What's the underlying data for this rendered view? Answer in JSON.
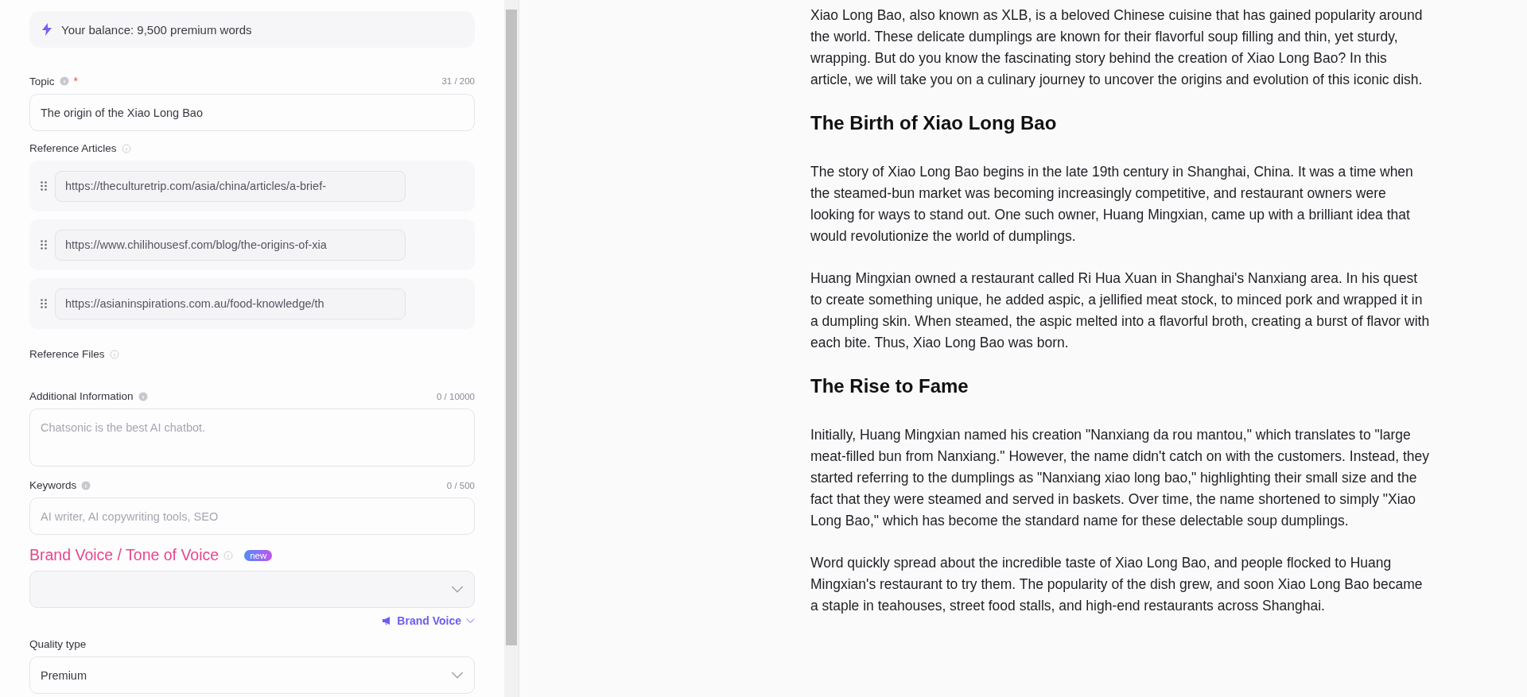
{
  "balance": {
    "text": "Your balance: 9,500 premium words"
  },
  "topic": {
    "label": "Topic",
    "required_mark": "*",
    "counter": "31 / 200",
    "value": "The origin of the Xiao Long Bao"
  },
  "reference_articles": {
    "label": "Reference Articles",
    "items": [
      {
        "url": "https://theculturetrip.com/asia/china/articles/a-brief-"
      },
      {
        "url": "https://www.chilihousesf.com/blog/the-origins-of-xia"
      },
      {
        "url": "https://asianinspirations.com.au/food-knowledge/th"
      }
    ]
  },
  "reference_files": {
    "label": "Reference Files"
  },
  "additional_information": {
    "label": "Additional Information",
    "counter": "0 / 10000",
    "placeholder": "Chatsonic is the best AI chatbot."
  },
  "keywords": {
    "label": "Keywords",
    "counter": "0 / 500",
    "placeholder": "AI writer, AI copywriting tools, SEO"
  },
  "brand_voice": {
    "label": "Brand Voice / Tone of Voice",
    "badge": "new",
    "link": "Brand Voice"
  },
  "quality_type": {
    "label": "Quality type",
    "value": "Premium"
  },
  "article": [
    {
      "kind": "paragraph",
      "text": "Xiao Long Bao, also known as XLB, is a beloved Chinese cuisine that has gained popularity around the world. These delicate dumplings are known for their flavorful soup filling and thin, yet sturdy, wrapping. But do you know the fascinating story behind the creation of Xiao Long Bao? In this article, we will take you on a culinary journey to uncover the origins and evolution of this iconic dish."
    },
    {
      "kind": "heading",
      "text": "The Birth of Xiao Long Bao"
    },
    {
      "kind": "paragraph",
      "text": "The story of Xiao Long Bao begins in the late 19th century in Shanghai, China. It was a time when the steamed-bun market was becoming increasingly competitive, and restaurant owners were looking for ways to stand out. One such owner, Huang Mingxian, came up with a brilliant idea that would revolutionize the world of dumplings."
    },
    {
      "kind": "paragraph",
      "text": "Huang Mingxian owned a restaurant called Ri Hua Xuan in Shanghai's Nanxiang area. In his quest to create something unique, he added aspic, a jellified meat stock, to minced pork and wrapped it in a dumpling skin. When steamed, the aspic melted into a flavorful broth, creating a burst of flavor with each bite. Thus, Xiao Long Bao was born."
    },
    {
      "kind": "heading",
      "text": "The Rise to Fame"
    },
    {
      "kind": "paragraph",
      "text": "Initially, Huang Mingxian named his creation \"Nanxiang da rou mantou,\" which translates to \"large meat-filled bun from Nanxiang.\" However, the name didn't catch on with the customers. Instead, they started referring to the dumplings as \"Nanxiang xiao long bao,\" highlighting their small size and the fact that they were steamed and served in baskets. Over time, the name shortened to simply \"Xiao Long Bao,\" which has become the standard name for these delectable soup dumplings."
    },
    {
      "kind": "paragraph",
      "text": "Word quickly spread about the incredible taste of Xiao Long Bao, and people flocked to Huang Mingxian's restaurant to try them. The popularity of the dish grew, and soon Xiao Long Bao became a staple in teahouses, street food stalls, and high-end restaurants across Shanghai."
    }
  ]
}
